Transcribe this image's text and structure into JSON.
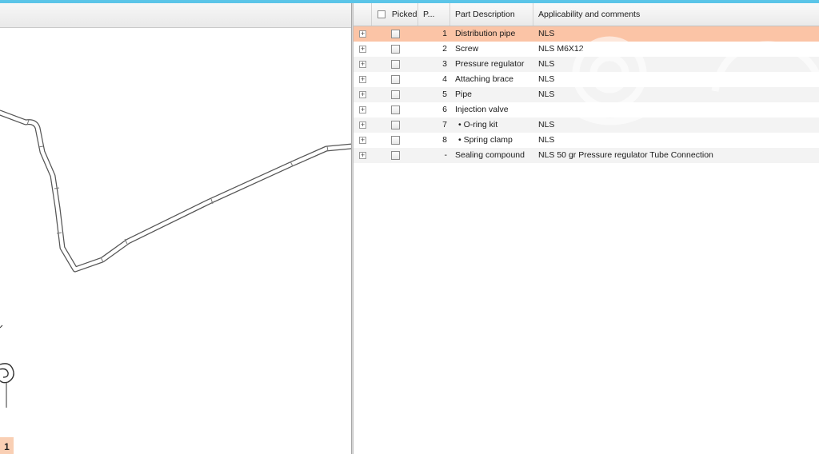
{
  "window": {
    "accent_color": "#5bc5e8",
    "selected_row_color": "#fbc4a6"
  },
  "diagram": {
    "callouts": [
      {
        "label": "1"
      }
    ]
  },
  "table": {
    "columns": {
      "picked": "Picked",
      "position": "P...",
      "description": "Part Description",
      "comments": "Applicability and comments"
    },
    "rows": [
      {
        "num": "1",
        "description": "Distribution pipe",
        "comments": "NLS",
        "selected": true
      },
      {
        "num": "2",
        "description": "Screw",
        "comments": "NLS M6X12"
      },
      {
        "num": "3",
        "description": "Pressure regulator",
        "comments": "NLS"
      },
      {
        "num": "4",
        "description": "Attaching brace",
        "comments": "NLS"
      },
      {
        "num": "5",
        "description": "Pipe",
        "comments": "NLS"
      },
      {
        "num": "6",
        "description": "Injection valve",
        "comments": ""
      },
      {
        "num": "7",
        "description": "• O-ring kit",
        "comments": "NLS"
      },
      {
        "num": "8",
        "description": "• Spring clamp",
        "comments": "NLS"
      },
      {
        "num": "-",
        "description": "Sealing compound",
        "comments": "NLS 50 gr Pressure regulator Tube Connection"
      }
    ]
  }
}
